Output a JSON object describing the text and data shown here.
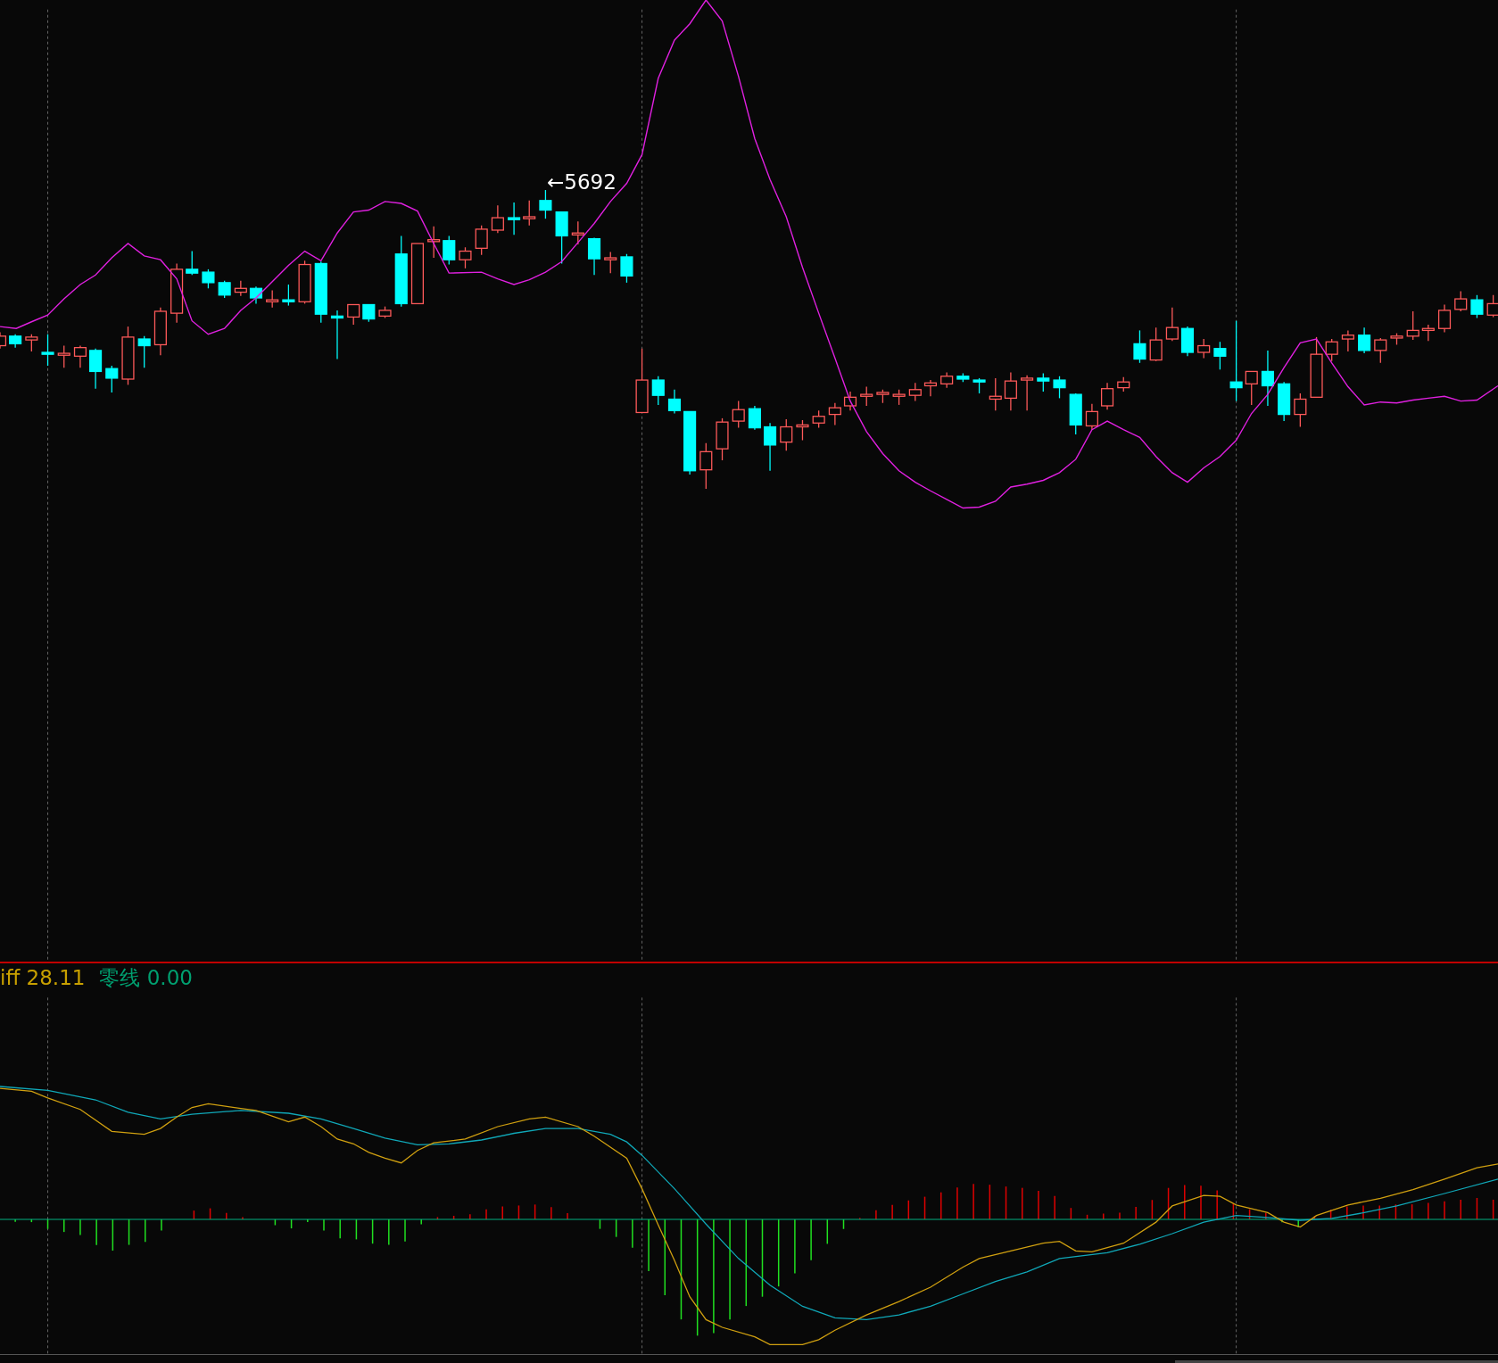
{
  "price_chart": {
    "peak_label": "←5692"
  },
  "macd_panel": {
    "legend": [
      {
        "kind": "diff",
        "text": "iff 28.11"
      },
      {
        "kind": "zero",
        "text": "零线 0.00"
      }
    ]
  }
}
